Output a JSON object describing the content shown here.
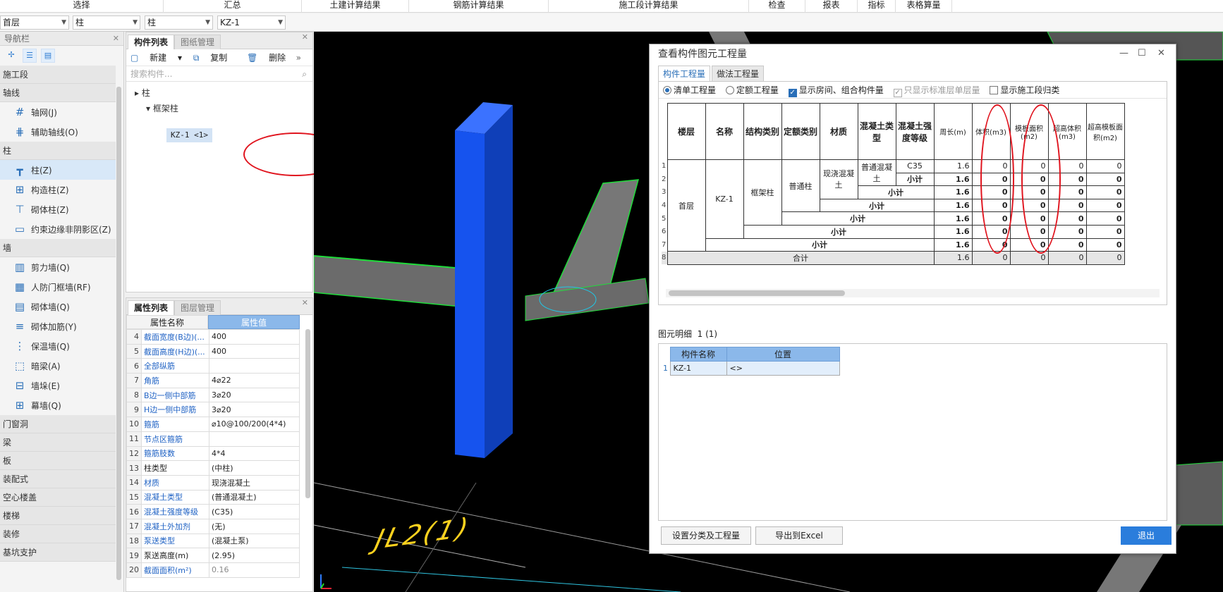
{
  "ribbon": {
    "groups": [
      "选择",
      "汇总",
      "土建计算结果",
      "钢筋计算结果",
      "施工段计算结果",
      "检查",
      "报表",
      "指标",
      "表格算量"
    ]
  },
  "selectors": {
    "floor": "首层",
    "type": "柱",
    "subtype": "柱",
    "component": "KZ-1"
  },
  "nav": {
    "title": "导航栏",
    "categories": {
      "c1": "施工段",
      "c2": "轴线",
      "c3": "柱",
      "c4": "墙",
      "c5": "门窗洞",
      "c6": "梁",
      "c7": "板",
      "c8": "装配式",
      "c9": "空心楼盖",
      "c10": "楼梯",
      "c11": "装修",
      "c12": "基坑支护"
    },
    "items": {
      "axis_grid": "轴网(J)",
      "aux_axis": "辅助轴线(O)",
      "column": "柱(Z)",
      "constr_column": "构造柱(Z)",
      "masonry_column": "砌体柱(Z)",
      "edge_zone": "约束边缘非阴影区(Z)",
      "shear_wall": "剪力墙(Q)",
      "civil_door": "人防门框墙(RF)",
      "masonry_wall": "砌体墙(Q)",
      "masonry_rebar": "砌体加筋(Y)",
      "insulation_wall": "保温墙(Q)",
      "hidden_beam": "暗梁(A)",
      "wall_pier": "墙垛(E)",
      "curtain_wall": "幕墙(Q)"
    }
  },
  "component_panel": {
    "tabs": [
      "构件列表",
      "图纸管理"
    ],
    "toolbar": {
      "new": "新建",
      "copy": "复制",
      "delete": "删除"
    },
    "search_placeholder": "搜索构件...",
    "tree": {
      "root": "柱",
      "group": "框架柱",
      "leaf": "KZ-1 <1>"
    }
  },
  "property_panel": {
    "tabs": [
      "属性列表",
      "图层管理"
    ],
    "headers": {
      "name": "属性名称",
      "value": "属性值"
    },
    "rows": [
      {
        "n": "4",
        "name": "截面宽度(B边)(...",
        "value": "400",
        "blue": true
      },
      {
        "n": "5",
        "name": "截面高度(H边)(...",
        "value": "400",
        "blue": true
      },
      {
        "n": "6",
        "name": "全部纵筋",
        "value": "",
        "blue": true
      },
      {
        "n": "7",
        "name": "角筋",
        "value": "4⌀22",
        "blue": true
      },
      {
        "n": "8",
        "name": "B边一侧中部筋",
        "value": "3⌀20",
        "blue": true
      },
      {
        "n": "9",
        "name": "H边一侧中部筋",
        "value": "3⌀20",
        "blue": true
      },
      {
        "n": "10",
        "name": "箍筋",
        "value": "⌀10@100/200(4*4)",
        "blue": true
      },
      {
        "n": "11",
        "name": "节点区箍筋",
        "value": "",
        "blue": true
      },
      {
        "n": "12",
        "name": "箍筋肢数",
        "value": "4*4",
        "blue": true
      },
      {
        "n": "13",
        "name": "柱类型",
        "value": "(中柱)",
        "blue": false
      },
      {
        "n": "14",
        "name": "材质",
        "value": "现浇混凝土",
        "blue": true
      },
      {
        "n": "15",
        "name": "混凝土类型",
        "value": "(普通混凝土)",
        "blue": true
      },
      {
        "n": "16",
        "name": "混凝土强度等级",
        "value": "(C35)",
        "blue": true
      },
      {
        "n": "17",
        "name": "混凝土外加剂",
        "value": "(无)",
        "blue": true
      },
      {
        "n": "18",
        "name": "泵送类型",
        "value": "(混凝土泵)",
        "blue": true
      },
      {
        "n": "19",
        "name": "泵送高度(m)",
        "value": "(2.95)",
        "blue": false
      },
      {
        "n": "20",
        "name": "截面面积(m²)",
        "value": "0.16",
        "blue": true
      }
    ]
  },
  "viewport": {
    "beam_label": "JL2(1)",
    "colors": {
      "column": "#1653ee",
      "background": "#000000",
      "beam_edge": "#1fdc3a"
    }
  },
  "dialog": {
    "title": "查看构件图元工程量",
    "tabs": [
      "构件工程量",
      "做法工程量"
    ],
    "options": {
      "bill_qty": "清单工程量",
      "quota_qty": "定额工程量",
      "show_room": "显示房间、组合构件量",
      "only_std_floor": "只显示标准层单层量",
      "show_section": "显示施工段归类"
    },
    "table": {
      "headers": [
        "楼层",
        "名称",
        "结构类别",
        "定额类别",
        "材质",
        "混凝土类型",
        "混凝土强度等级",
        "周长(m)",
        "体积(m3)",
        "模板面积(m2)",
        "超高体积(m3)",
        "超高模板面积(m2)"
      ],
      "floor": "首层",
      "name": "KZ-1",
      "struct": "框架柱",
      "quota": "普通柱",
      "material": "现浇混凝土",
      "conc_type": "普通混凝土",
      "grade": "C35",
      "subtotal": "小计",
      "total": "合计",
      "row_numbers": [
        "1",
        "2",
        "3",
        "4",
        "5",
        "6",
        "7",
        "8"
      ],
      "perimeter": "1.6",
      "zero": "0"
    },
    "detail": {
      "label": "图元明细",
      "count": "1 (1)",
      "headers": [
        "构件名称",
        "位置"
      ],
      "row": {
        "n": "1",
        "name": "KZ-1",
        "pos": "<>"
      }
    },
    "buttons": {
      "settings": "设置分类及工程量",
      "export": "导出到Excel",
      "exit": "退出"
    }
  }
}
